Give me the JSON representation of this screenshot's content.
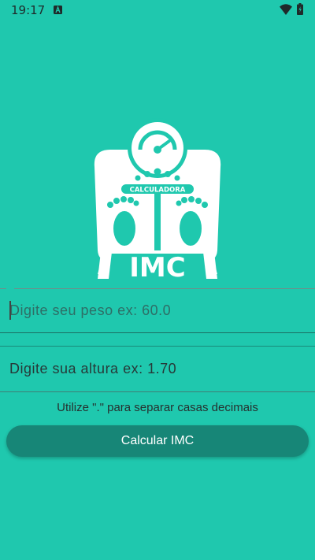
{
  "status_bar": {
    "time": "19:17",
    "icons": [
      "notification-a-icon",
      "wifi-icon",
      "battery-icon"
    ]
  },
  "logo": {
    "top_text": "CALCULADORA",
    "main_text": "IMC"
  },
  "form": {
    "weight_placeholder": "Digite seu peso ex: 60.0",
    "height_placeholder": "Digite sua altura ex: 1.70",
    "hint": "Utilize \".\" para separar casas decimais",
    "button_label": "Calcular IMC"
  },
  "colors": {
    "background": "#1fc8ae",
    "button": "#178677",
    "logo": "#ffffff"
  }
}
